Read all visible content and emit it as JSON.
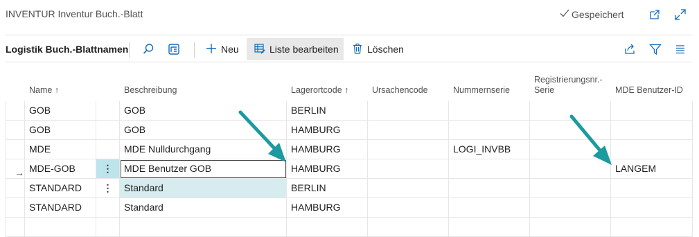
{
  "page": {
    "title": "INVENTUR Inventur Buch.-Blatt",
    "saved_status": "Gespeichert"
  },
  "actionbar": {
    "title": "Logistik Buch.-Blattnamen",
    "new_label": "Neu",
    "edit_list_label": "Liste bearbeiten",
    "delete_label": "Löschen"
  },
  "columns": {
    "name": "Name ↑",
    "description": "Beschreibung",
    "location": "Lagerortcode ↑",
    "reason": "Ursachencode",
    "number_series": "Nummernserie",
    "registration_series": "Registrierungsnr.-Serie",
    "mde_user": "MDE Benutzer-ID"
  },
  "rows": [
    {
      "name": "GOB",
      "description": "GOB",
      "location": "BERLIN",
      "reason": "",
      "number_series": "",
      "registration_series": "",
      "mde_user": ""
    },
    {
      "name": "GOB",
      "description": "GOB",
      "location": "HAMBURG",
      "reason": "",
      "number_series": "",
      "registration_series": "",
      "mde_user": ""
    },
    {
      "name": "MDE",
      "description": "MDE Nulldurchgang",
      "location": "HAMBURG",
      "reason": "",
      "number_series": "LOGI_INVBB",
      "registration_series": "",
      "mde_user": ""
    },
    {
      "name": "MDE-GOB",
      "description": "MDE Benutzer GOB",
      "location": "HAMBURG",
      "reason": "",
      "number_series": "",
      "registration_series": "",
      "mde_user": "LANGEM"
    },
    {
      "name": "STANDARD",
      "description": "Standard",
      "location": "BERLIN",
      "reason": "",
      "number_series": "",
      "registration_series": "",
      "mde_user": ""
    },
    {
      "name": "STANDARD",
      "description": "Standard",
      "location": "HAMBURG",
      "reason": "",
      "number_series": "",
      "registration_series": "",
      "mde_user": ""
    }
  ],
  "row_indicator": "→",
  "row_menu_glyph": "⋮",
  "colors": {
    "arrow": "#1b9aa0",
    "selection": "#d6ecef",
    "menu_cell": "#bde4ea",
    "accent": "#0f6cbd"
  },
  "icons": [
    "checkmark-icon",
    "open-in-new-window-icon",
    "expand-icon",
    "search-icon",
    "filter-pane-icon",
    "plus-icon",
    "edit-list-icon",
    "delete-icon",
    "share-icon",
    "filter-icon",
    "list-view-icon"
  ]
}
